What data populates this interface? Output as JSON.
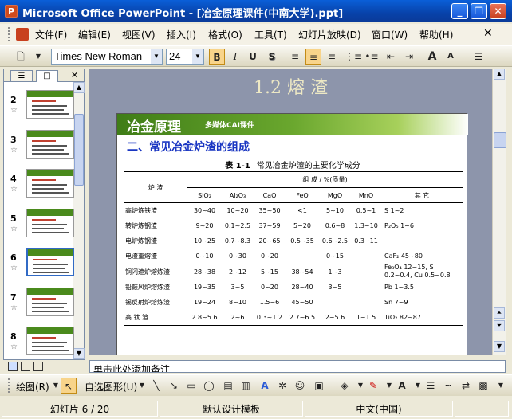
{
  "window": {
    "title": "Microsoft Office PowerPoint - [冶金原理课件(中南大学).ppt]",
    "app_icon": "P",
    "minimize": "_",
    "restore": "❐",
    "close": "✕"
  },
  "menu": {
    "items": [
      "文件(F)",
      "编辑(E)",
      "视图(V)",
      "插入(I)",
      "格式(O)",
      "工具(T)",
      "幻灯片放映(D)",
      "窗口(W)",
      "帮助(H)"
    ]
  },
  "format_toolbar": {
    "font_name": "Times New Roman",
    "font_size": "24",
    "bold": "B",
    "italic": "I",
    "underline": "U",
    "shadow": "S",
    "grow_font": "A",
    "shrink_font": "A"
  },
  "slides_pane": {
    "tabs": [
      "☰",
      "□"
    ],
    "close": "✕",
    "star": "☆",
    "thumbnails": [
      {
        "number": "2",
        "selected": false
      },
      {
        "number": "3",
        "selected": false
      },
      {
        "number": "4",
        "selected": false
      },
      {
        "number": "5",
        "selected": false
      },
      {
        "number": "6",
        "selected": true
      },
      {
        "number": "7",
        "selected": false
      },
      {
        "number": "8",
        "selected": false
      }
    ]
  },
  "slide": {
    "title": "1.2 熔 渣",
    "brand": "冶金原理",
    "brand_sub": "多媒体CAI课件",
    "heading": "二、常见冶金炉渣的组成",
    "table_caption_no": "表 1-1",
    "table_caption": "常见冶金炉渣的主要化学成分",
    "table": {
      "col_furnace": "炉  渣",
      "group_header": "组   成 / %(质量)",
      "components": [
        "SiO₂",
        "Al₂O₃",
        "CaO",
        "FeO",
        "MgO",
        "MnO",
        "其  它"
      ],
      "rows": [
        {
          "name": "高炉炼铁渣",
          "values": [
            "30~40",
            "10~20",
            "35~50",
            "<1",
            "5~10",
            "0.5~1",
            "S 1~2"
          ]
        },
        {
          "name": "转炉炼钢渣",
          "values": [
            "9~20",
            "0.1~2.5",
            "37~59",
            "5~20",
            "0.6~8",
            "1.3~10",
            "P₂O₅ 1~6"
          ]
        },
        {
          "name": "电炉炼钢渣",
          "values": [
            "10~25",
            "0.7~8.3",
            "20~65",
            "0.5~35",
            "0.6~2.5",
            "0.3~11",
            ""
          ]
        },
        {
          "name": "电渣重熔渣",
          "values": [
            "0~10",
            "0~30",
            "0~20",
            "",
            "0~15",
            "",
            "CaF₂ 45~80"
          ]
        },
        {
          "name": "铜闪速炉熔炼渣",
          "values": [
            "28~38",
            "2~12",
            "5~15",
            "38~54",
            "1~3",
            "",
            "Fe₃O₄ 12~15, S 0.2~0.4, Cu 0.5~0.8"
          ]
        },
        {
          "name": "铅鼓风炉熔炼渣",
          "values": [
            "19~35",
            "3~5",
            "0~20",
            "28~40",
            "3~5",
            "",
            "Pb 1~3.5"
          ]
        },
        {
          "name": "锡反射炉熔炼渣",
          "values": [
            "19~24",
            "8~10",
            "1.5~6",
            "45~50",
            "",
            "",
            "Sn 7~9"
          ]
        },
        {
          "name": "高  钛  渣",
          "values": [
            "2.8~5.6",
            "2~6",
            "0.3~1.2",
            "2.7~6.5",
            "2~5.6",
            "1~1.5",
            "TiO₂ 82~87"
          ]
        }
      ]
    }
  },
  "notes_placeholder": "单击此处添加备注",
  "drawing_toolbar": {
    "draw_label": "绘图(R)",
    "autoshapes_label": "自选图形(U)"
  },
  "status_bar": {
    "slide_position": "幻灯片 6 / 20",
    "design_template": "默认设计模板",
    "language": "中文(中国)"
  }
}
